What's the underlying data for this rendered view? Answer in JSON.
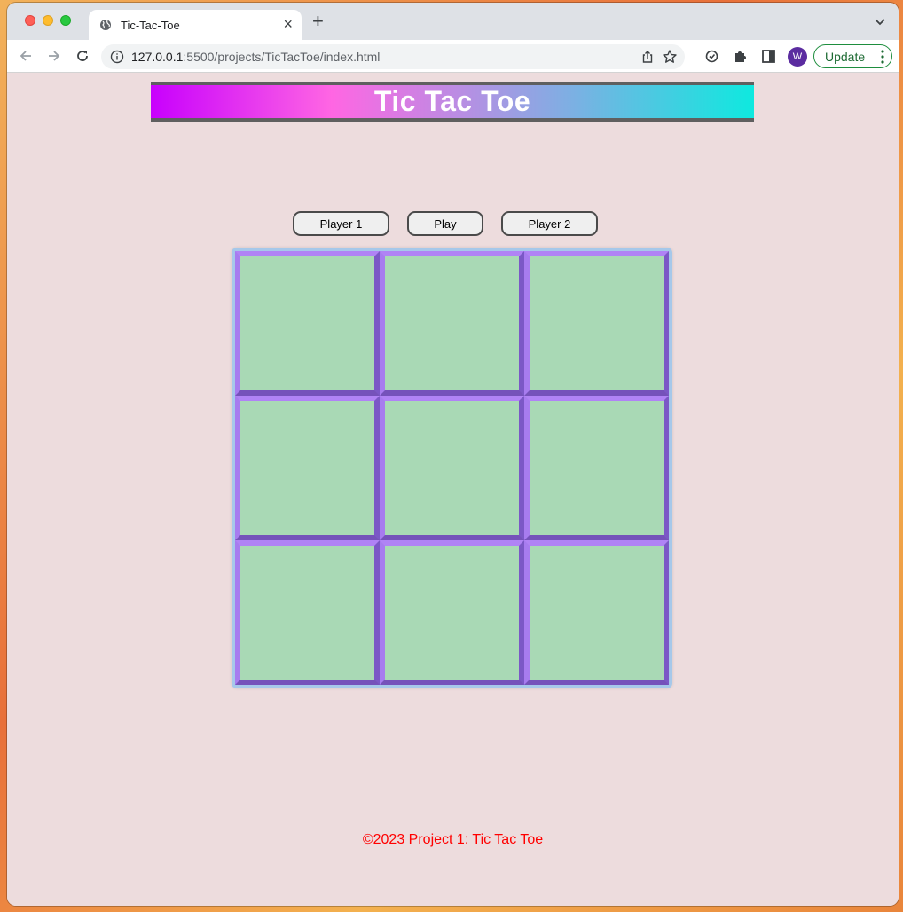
{
  "browser": {
    "tab_title": "Tic-Tac-Toe",
    "url_host": "127.0.0.1",
    "url_path": ":5500/projects/TicTacToe/index.html",
    "profile_initial": "W",
    "update_label": "Update"
  },
  "page": {
    "title": "Tic Tac Toe",
    "buttons": {
      "player1": "Player 1",
      "play": "Play",
      "player2": "Player 2"
    },
    "board": {
      "cells": [
        "",
        "",
        "",
        "",
        "",
        "",
        "",
        "",
        ""
      ]
    },
    "footer": "©2023 Project 1: Tic Tac Toe"
  },
  "colors": {
    "cell_fill": "#a9d9b5",
    "cell_border": "#b083f5",
    "footer_text": "#ff0000"
  }
}
